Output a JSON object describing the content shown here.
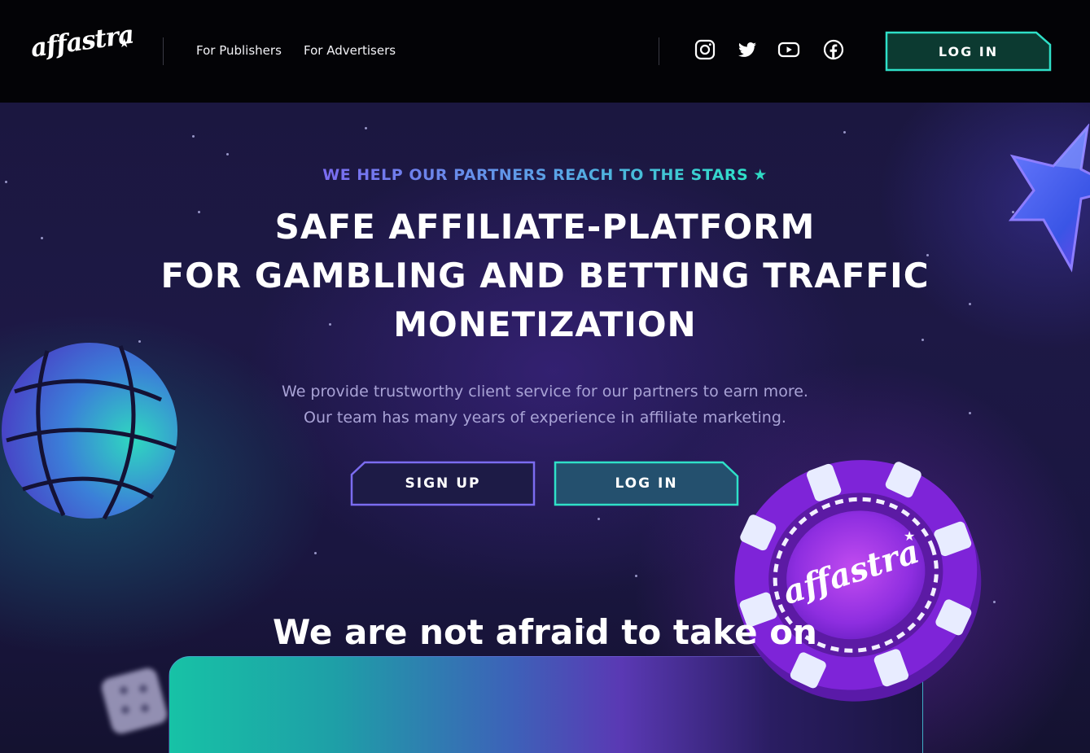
{
  "brand": {
    "logo_text": "affastra"
  },
  "nav": {
    "for_publishers": "For Publishers",
    "for_advertisers": "For Advertisers"
  },
  "social": [
    "instagram-icon",
    "twitter-icon",
    "youtube-icon",
    "facebook-icon"
  ],
  "header": {
    "login_label": "LOG IN"
  },
  "hero": {
    "tagline": "WE HELP OUR PARTNERS REACH TO THE STARS",
    "headline_lines": [
      "SAFE AFFILIATE-PLATFORM",
      "FOR GAMBLING AND BETTING TRAFFIC",
      "MONETIZATION"
    ],
    "description_lines": [
      "We provide trustworthy client service for our partners to earn more.",
      "Our team has many years of experience in affiliate marketing."
    ],
    "signup_label": "SIGN UP",
    "login_label": "LOG IN"
  },
  "chip": {
    "logo_text": "affastra"
  },
  "section": {
    "title": "We are not afraid to take on"
  },
  "colors": {
    "accent_teal": "#2fe0c8",
    "accent_purple": "#7b6cf0",
    "header_bg": "#030306",
    "hero_bg": "#1b1740"
  }
}
